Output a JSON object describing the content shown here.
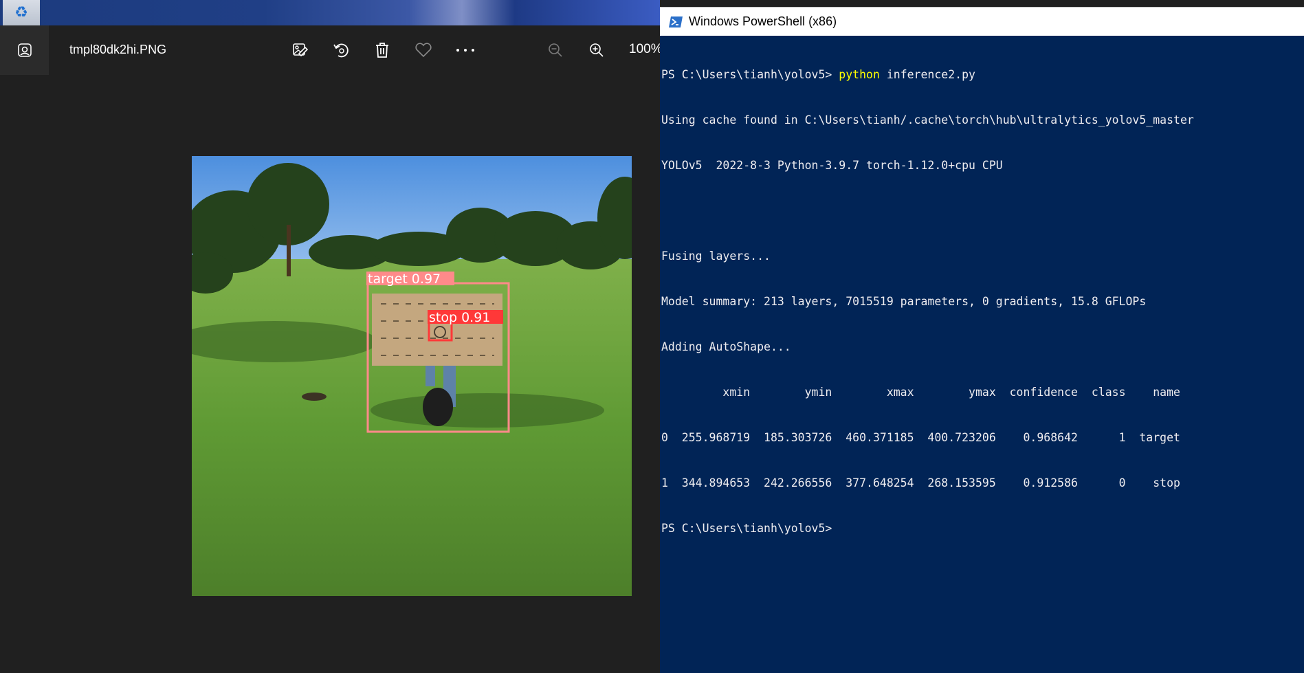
{
  "photos_app": {
    "filename": "tmpl80dk2hi.PNG",
    "zoom": "100%",
    "toolbar_icons": [
      "edit-image-icon",
      "rotate-icon",
      "delete-icon",
      "favorite-icon",
      "more-icon",
      "zoom-out-icon",
      "zoom-in-icon"
    ],
    "detections": [
      {
        "label": "target 0.97",
        "color": "#ff8a8a"
      },
      {
        "label": "stop 0.91",
        "color": "#ff3838"
      }
    ]
  },
  "powershell": {
    "title": "Windows PowerShell (x86)",
    "prompt1": "PS C:\\Users\\tianh\\yolov5> ",
    "command_keyword": "python",
    "command_rest": " inference2.py",
    "lines": [
      "Using cache found in C:\\Users\\tianh/.cache\\torch\\hub\\ultralytics_yolov5_master",
      "YOLOv5  2022-8-3 Python-3.9.7 torch-1.12.0+cpu CPU",
      "",
      "Fusing layers...",
      "Model summary: 213 layers, 7015519 parameters, 0 gradients, 15.8 GFLOPs",
      "Adding AutoShape...",
      "         xmin        ymin        xmax        ymax  confidence  class    name",
      "0  255.968719  185.303726  460.371185  400.723206    0.968642      1  target",
      "1  344.894653  242.266556  377.648254  268.153595    0.912586      0    stop",
      "PS C:\\Users\\tianh\\yolov5>"
    ]
  }
}
